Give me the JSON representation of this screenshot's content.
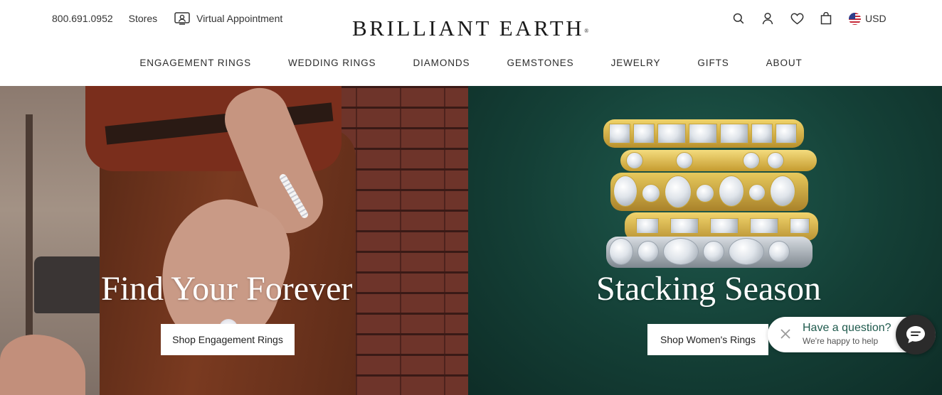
{
  "header": {
    "phone": "800.691.0952",
    "stores_label": "Stores",
    "virtual_appointment_label": "Virtual Appointment",
    "logo_text": "BRILLIANT EARTH",
    "logo_mark": "®",
    "icons": [
      "search-icon",
      "account-icon",
      "heart-icon",
      "bag-icon"
    ],
    "currency": "USD"
  },
  "nav": {
    "items": [
      {
        "label": "ENGAGEMENT RINGS"
      },
      {
        "label": "WEDDING RINGS"
      },
      {
        "label": "DIAMONDS"
      },
      {
        "label": "GEMSTONES"
      },
      {
        "label": "JEWELRY"
      },
      {
        "label": "GIFTS"
      },
      {
        "label": "ABOUT"
      }
    ]
  },
  "hero": {
    "left": {
      "title": "Find Your Forever",
      "button_label": "Shop Engagement Rings"
    },
    "right": {
      "title": "Stacking Season",
      "button_label": "Shop Women's Rings"
    }
  },
  "chat": {
    "title": "Have a question?",
    "subtitle": "We're happy to help"
  },
  "colors": {
    "brand_green": "#1f5a4d",
    "panel_green": "#143f36",
    "panel_brown": "#5b2f22",
    "chat_button": "#2b2b2b"
  }
}
